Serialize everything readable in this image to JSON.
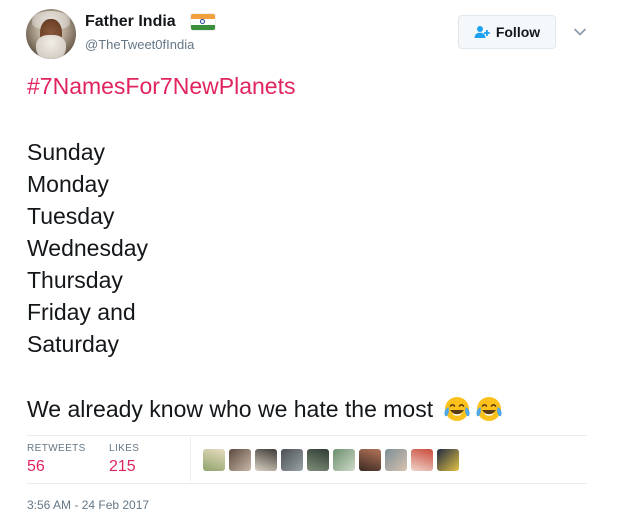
{
  "author": {
    "display_name": "Father India",
    "handle": "@TheTweet0fIndia",
    "avatar_icon": "bearded-elder-avatar",
    "flag_icon": "india-flag-icon"
  },
  "actions": {
    "follow_label": "Follow",
    "follow_icon": "add-user-icon",
    "more_icon": "chevron-down-icon"
  },
  "tweet": {
    "hashtag": "#7NamesFor7NewPlanets",
    "lines": [
      "Sunday",
      "Monday",
      "Tuesday",
      "Wednesday",
      "Thursday",
      "Friday and",
      "Saturday"
    ],
    "closing": "We already know who we hate the most",
    "emoji": [
      "tears-of-joy-emoji",
      "tears-of-joy-emoji"
    ]
  },
  "stats": {
    "retweets_label": "RETWEETS",
    "retweets_count": "56",
    "likes_label": "LIKES",
    "likes_count": "215"
  },
  "likers": [
    {
      "icon": "liker-avatar-1",
      "colors": [
        "#e8dcc0",
        "#8fa46b"
      ]
    },
    {
      "icon": "liker-avatar-2",
      "colors": [
        "#5d4a40",
        "#c9b8a8"
      ]
    },
    {
      "icon": "liker-avatar-3",
      "colors": [
        "#3d3a36",
        "#d9d1c3"
      ]
    },
    {
      "icon": "liker-avatar-4",
      "colors": [
        "#4a4f52",
        "#9aa3a6"
      ]
    },
    {
      "icon": "liker-avatar-5",
      "colors": [
        "#2f3b33",
        "#7f8e7a"
      ]
    },
    {
      "icon": "liker-avatar-6",
      "colors": [
        "#6a8f6e",
        "#cfdac8"
      ]
    },
    {
      "icon": "liker-avatar-7",
      "colors": [
        "#b3745a",
        "#3b2a22"
      ]
    },
    {
      "icon": "liker-avatar-8",
      "colors": [
        "#7c8e95",
        "#d7c3b0"
      ]
    },
    {
      "icon": "liker-avatar-9",
      "colors": [
        "#c94a3c",
        "#f0d5c9"
      ]
    },
    {
      "icon": "liker-avatar-10",
      "colors": [
        "#1f2a44",
        "#e3c243"
      ]
    }
  ],
  "timestamp": "3:56 AM - 24 Feb 2017",
  "colors": {
    "hashtag": "#e0245e",
    "stat_value": "#e0245e",
    "muted": "#657786",
    "follow_icon": "#1da1f2"
  }
}
